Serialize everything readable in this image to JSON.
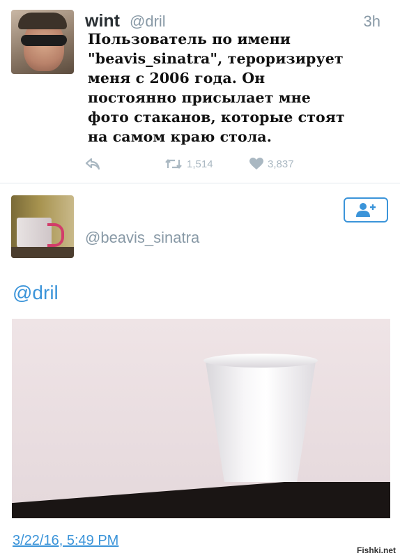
{
  "tweet": {
    "author_name": "wint",
    "author_handle": "@dril",
    "time": "3h",
    "text": "Пользователь по имени\n\"beavis_sinatra\", тероризирует\nменя с 2006 года. Он\nпостоянно присылает мне\nфото стаканов, которые стоят\nна самом краю стола.",
    "retweets": "1,514",
    "likes": "3,837",
    "icons": {
      "reply": "reply-icon",
      "retweet": "retweet-icon",
      "like": "heart-icon"
    }
  },
  "reply": {
    "author_handle": "@beavis_sinatra",
    "text": "@dril",
    "timestamp": "3/22/16, 5:49 PM",
    "follow_icon": "add-user-icon"
  },
  "watermark": "Fishki.net",
  "colors": {
    "link": "#3b94d9",
    "muted": "#8899a6",
    "action": "#aab8c2"
  }
}
